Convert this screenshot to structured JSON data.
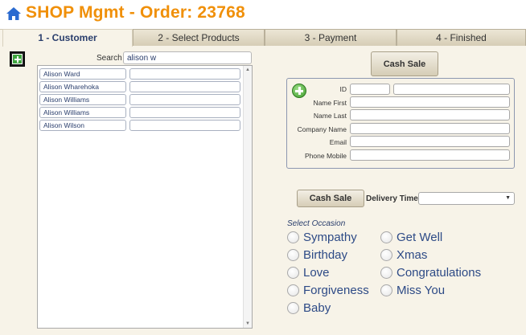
{
  "header": {
    "title": "SHOP Mgmt - Order: 23768"
  },
  "tabs": [
    {
      "label": "1 - Customer"
    },
    {
      "label": "2 - Select Products"
    },
    {
      "label": "3 - Payment"
    },
    {
      "label": "4 - Finished"
    }
  ],
  "search": {
    "label": "Search",
    "value": "alison w"
  },
  "customers": [
    {
      "name": "Alison Ward",
      "extra": ""
    },
    {
      "name": "Alison Wharehoka",
      "extra": ""
    },
    {
      "name": "Alison Williams",
      "extra": ""
    },
    {
      "name": "Alison Williams",
      "extra": ""
    },
    {
      "name": "Alison Wilson",
      "extra": ""
    }
  ],
  "cash_sale_top": "Cash Sale",
  "cash_sale_mid": "Cash Sale",
  "form": {
    "id_label": "ID",
    "name_first_label": "Name First",
    "name_last_label": "Name Last",
    "company_label": "Company Name",
    "email_label": "Email",
    "phone_label": "Phone Mobile"
  },
  "delivery": {
    "label": "Delivery Time",
    "value": ""
  },
  "occasion": {
    "title": "Select Occasion",
    "options": [
      "Sympathy",
      "Get Well",
      "Birthday",
      "Xmas",
      "Love",
      "Congratulations",
      "Forgiveness",
      "Miss You",
      "Baby"
    ]
  },
  "colors": {
    "title": "#f0900a",
    "accent": "#2d4a86",
    "panel": "#f7f3e8"
  }
}
